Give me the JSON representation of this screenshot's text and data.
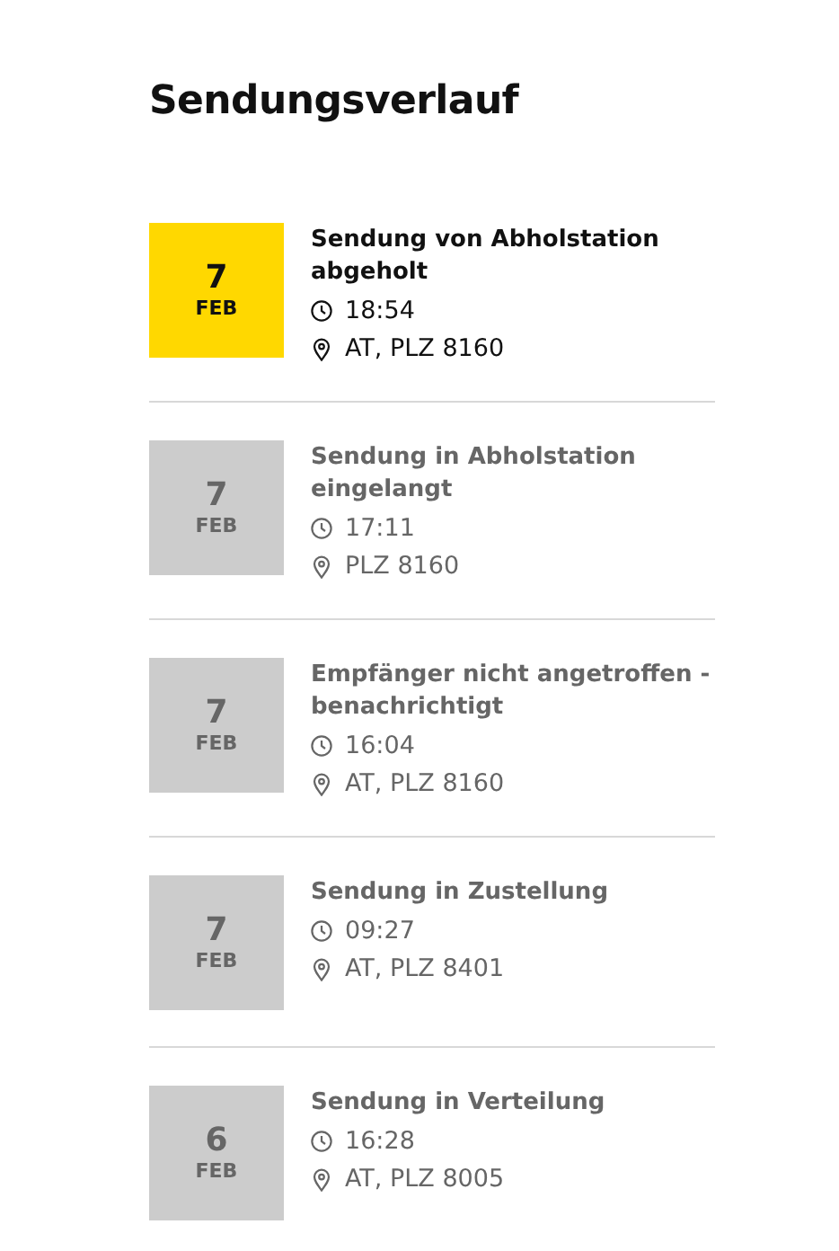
{
  "title": "Sendungsverlauf",
  "events": [
    {
      "day": "7",
      "month": "FEB",
      "status": "Sendung von Abholstation abgeholt",
      "time": "18:54",
      "location": "AT, PLZ 8160",
      "current": true
    },
    {
      "day": "7",
      "month": "FEB",
      "status": "Sendung in Abholstation eingelangt",
      "time": "17:11",
      "location": "PLZ 8160",
      "current": false
    },
    {
      "day": "7",
      "month": "FEB",
      "status": "Empfänger nicht angetroffen - benachrichtigt",
      "time": "16:04",
      "location": "AT, PLZ 8160",
      "current": false
    },
    {
      "day": "7",
      "month": "FEB",
      "status": "Sendung in Zustellung",
      "time": "09:27",
      "location": "AT, PLZ 8401",
      "current": false
    },
    {
      "day": "6",
      "month": "FEB",
      "status": "Sendung in Verteilung",
      "time": "16:28",
      "location": "AT, PLZ 8005",
      "current": false
    }
  ]
}
